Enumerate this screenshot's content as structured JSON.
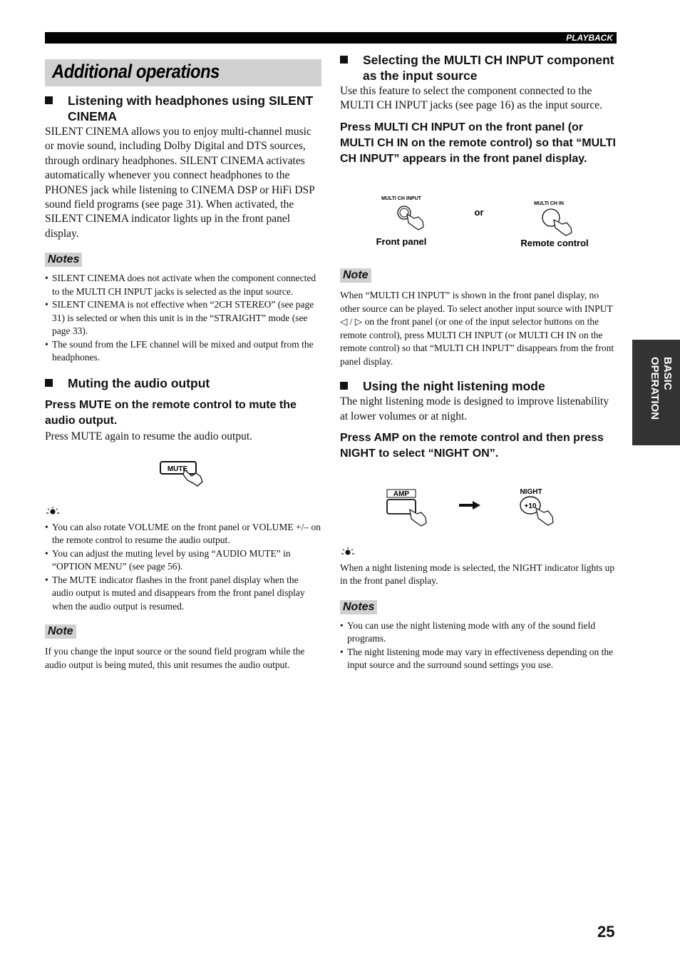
{
  "header": {
    "section_label": "PLAYBACK"
  },
  "page": {
    "title": "Additional operations",
    "page_number": "25",
    "side_tab": "BASIC OPERATION"
  },
  "left": {
    "silent_cinema": {
      "heading": "Listening with headphones using SILENT CINEMA",
      "body": "SILENT CINEMA allows you to enjoy multi-channel music or movie sound, including Dolby Digital and DTS sources, through ordinary headphones. SILENT CINEMA activates automatically whenever you connect headphones to the PHONES jack while listening to CINEMA DSP or HiFi DSP sound field programs (see page 31). When activated, the SILENT CINEMA indicator lights up in the front panel display.",
      "notes_label": "Notes",
      "notes": [
        "SILENT CINEMA does not activate when the component connected to the MULTI CH INPUT jacks is selected as the input source.",
        "SILENT CINEMA is not effective when “2CH STEREO” (see page 31) is selected or when this unit is in the “STRAIGHT” mode (see page 33).",
        "The sound from the LFE channel will be mixed and output from the headphones."
      ]
    },
    "muting": {
      "heading": "Muting the audio output",
      "instruction": "Press MUTE on the remote control to mute the audio output.",
      "body": "Press MUTE again to resume the audio output.",
      "button_label": "MUTE",
      "tip_icon": "lightbulb-tip-icon",
      "tips": [
        "You can also rotate VOLUME on the front panel or VOLUME +/– on the remote control to resume the audio output.",
        "You can adjust the muting level by using “AUDIO MUTE” in “OPTION MENU” (see page 56).",
        "The MUTE indicator flashes in the front panel display when the audio output is muted and disappears from the front panel display when the audio output is resumed."
      ],
      "note_label": "Note",
      "note": "If you change the input source or the sound field program while the audio output is being muted, this unit resumes the audio output."
    }
  },
  "right": {
    "multi_ch": {
      "heading": "Selecting the MULTI CH INPUT component as the input source",
      "body": "Use this feature to select the component connected to the MULTI CH INPUT jacks (see page 16) as the input source.",
      "instruction": "Press MULTI CH INPUT on the front panel (or MULTI CH IN on the remote control) so that “MULTI CH INPUT” appears in the front panel display.",
      "figure": {
        "front_button_label": "MULTI CH INPUT",
        "front_caption": "Front panel",
        "or_label": "or",
        "remote_button_label": "MULTI CH IN",
        "remote_caption": "Remote control"
      },
      "note_label": "Note",
      "note": "When “MULTI CH INPUT” is shown in the front panel display, no other source can be played. To select another input source with INPUT ◁ / ▷ on the front panel (or one of the input selector buttons on the remote control), press MULTI CH INPUT (or MULTI CH IN on the remote control) so that “MULTI CH INPUT” disappears from the front panel display."
    },
    "night": {
      "heading": "Using the night listening mode",
      "body": "The night listening mode is designed to improve listenability at lower volumes or at night.",
      "instruction": "Press AMP on the remote control and then press NIGHT to select “NIGHT ON”.",
      "figure": {
        "amp_label": "AMP",
        "night_label": "NIGHT",
        "night_button": "+10"
      },
      "tip_icon": "lightbulb-tip-icon",
      "tip": "When a night listening mode is selected, the NIGHT indicator lights up in the front panel display.",
      "notes_label": "Notes",
      "notes": [
        "You can use the night listening mode with any of the sound field programs.",
        "The night listening mode may vary in effectiveness depending on the input source and the surround sound settings you use."
      ]
    }
  }
}
